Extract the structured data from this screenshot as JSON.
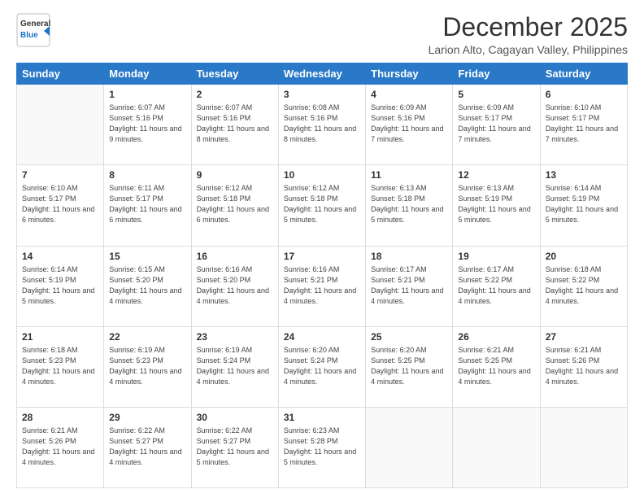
{
  "logo": {
    "line1": "General",
    "line2": "Blue"
  },
  "title": "December 2025",
  "location": "Larion Alto, Cagayan Valley, Philippines",
  "days_of_week": [
    "Sunday",
    "Monday",
    "Tuesday",
    "Wednesday",
    "Thursday",
    "Friday",
    "Saturday"
  ],
  "weeks": [
    [
      {
        "day": "",
        "sunrise": "",
        "sunset": "",
        "daylight": ""
      },
      {
        "day": "1",
        "sunrise": "6:07 AM",
        "sunset": "5:16 PM",
        "daylight": "11 hours and 9 minutes."
      },
      {
        "day": "2",
        "sunrise": "6:07 AM",
        "sunset": "5:16 PM",
        "daylight": "11 hours and 8 minutes."
      },
      {
        "day": "3",
        "sunrise": "6:08 AM",
        "sunset": "5:16 PM",
        "daylight": "11 hours and 8 minutes."
      },
      {
        "day": "4",
        "sunrise": "6:09 AM",
        "sunset": "5:16 PM",
        "daylight": "11 hours and 7 minutes."
      },
      {
        "day": "5",
        "sunrise": "6:09 AM",
        "sunset": "5:17 PM",
        "daylight": "11 hours and 7 minutes."
      },
      {
        "day": "6",
        "sunrise": "6:10 AM",
        "sunset": "5:17 PM",
        "daylight": "11 hours and 7 minutes."
      }
    ],
    [
      {
        "day": "7",
        "sunrise": "6:10 AM",
        "sunset": "5:17 PM",
        "daylight": "11 hours and 6 minutes."
      },
      {
        "day": "8",
        "sunrise": "6:11 AM",
        "sunset": "5:17 PM",
        "daylight": "11 hours and 6 minutes."
      },
      {
        "day": "9",
        "sunrise": "6:12 AM",
        "sunset": "5:18 PM",
        "daylight": "11 hours and 6 minutes."
      },
      {
        "day": "10",
        "sunrise": "6:12 AM",
        "sunset": "5:18 PM",
        "daylight": "11 hours and 5 minutes."
      },
      {
        "day": "11",
        "sunrise": "6:13 AM",
        "sunset": "5:18 PM",
        "daylight": "11 hours and 5 minutes."
      },
      {
        "day": "12",
        "sunrise": "6:13 AM",
        "sunset": "5:19 PM",
        "daylight": "11 hours and 5 minutes."
      },
      {
        "day": "13",
        "sunrise": "6:14 AM",
        "sunset": "5:19 PM",
        "daylight": "11 hours and 5 minutes."
      }
    ],
    [
      {
        "day": "14",
        "sunrise": "6:14 AM",
        "sunset": "5:19 PM",
        "daylight": "11 hours and 5 minutes."
      },
      {
        "day": "15",
        "sunrise": "6:15 AM",
        "sunset": "5:20 PM",
        "daylight": "11 hours and 4 minutes."
      },
      {
        "day": "16",
        "sunrise": "6:16 AM",
        "sunset": "5:20 PM",
        "daylight": "11 hours and 4 minutes."
      },
      {
        "day": "17",
        "sunrise": "6:16 AM",
        "sunset": "5:21 PM",
        "daylight": "11 hours and 4 minutes."
      },
      {
        "day": "18",
        "sunrise": "6:17 AM",
        "sunset": "5:21 PM",
        "daylight": "11 hours and 4 minutes."
      },
      {
        "day": "19",
        "sunrise": "6:17 AM",
        "sunset": "5:22 PM",
        "daylight": "11 hours and 4 minutes."
      },
      {
        "day": "20",
        "sunrise": "6:18 AM",
        "sunset": "5:22 PM",
        "daylight": "11 hours and 4 minutes."
      }
    ],
    [
      {
        "day": "21",
        "sunrise": "6:18 AM",
        "sunset": "5:23 PM",
        "daylight": "11 hours and 4 minutes."
      },
      {
        "day": "22",
        "sunrise": "6:19 AM",
        "sunset": "5:23 PM",
        "daylight": "11 hours and 4 minutes."
      },
      {
        "day": "23",
        "sunrise": "6:19 AM",
        "sunset": "5:24 PM",
        "daylight": "11 hours and 4 minutes."
      },
      {
        "day": "24",
        "sunrise": "6:20 AM",
        "sunset": "5:24 PM",
        "daylight": "11 hours and 4 minutes."
      },
      {
        "day": "25",
        "sunrise": "6:20 AM",
        "sunset": "5:25 PM",
        "daylight": "11 hours and 4 minutes."
      },
      {
        "day": "26",
        "sunrise": "6:21 AM",
        "sunset": "5:25 PM",
        "daylight": "11 hours and 4 minutes."
      },
      {
        "day": "27",
        "sunrise": "6:21 AM",
        "sunset": "5:26 PM",
        "daylight": "11 hours and 4 minutes."
      }
    ],
    [
      {
        "day": "28",
        "sunrise": "6:21 AM",
        "sunset": "5:26 PM",
        "daylight": "11 hours and 4 minutes."
      },
      {
        "day": "29",
        "sunrise": "6:22 AM",
        "sunset": "5:27 PM",
        "daylight": "11 hours and 4 minutes."
      },
      {
        "day": "30",
        "sunrise": "6:22 AM",
        "sunset": "5:27 PM",
        "daylight": "11 hours and 5 minutes."
      },
      {
        "day": "31",
        "sunrise": "6:23 AM",
        "sunset": "5:28 PM",
        "daylight": "11 hours and 5 minutes."
      },
      {
        "day": "",
        "sunrise": "",
        "sunset": "",
        "daylight": ""
      },
      {
        "day": "",
        "sunrise": "",
        "sunset": "",
        "daylight": ""
      },
      {
        "day": "",
        "sunrise": "",
        "sunset": "",
        "daylight": ""
      }
    ]
  ]
}
